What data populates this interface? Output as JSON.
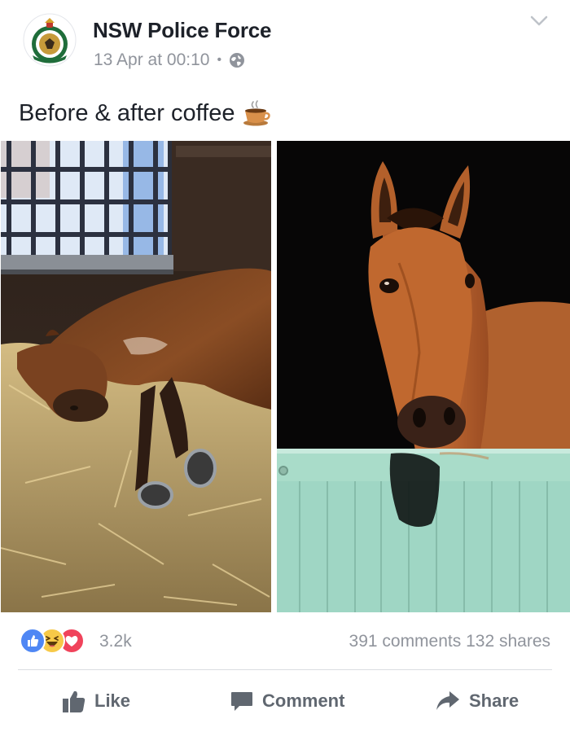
{
  "post": {
    "page_name": "NSW Police Force",
    "timestamp": "13 Apr at 00:10",
    "separator": "•",
    "privacy_icon": "globe-icon",
    "menu_icon": "chevron-down-icon",
    "text": "Before & after coffee",
    "emoji": "coffee-cup-emoji",
    "photos": [
      {
        "name": "photo-before",
        "description_icon": "sleeping-horse-photo"
      },
      {
        "name": "photo-after",
        "description_icon": "alert-horse-photo"
      }
    ]
  },
  "stats": {
    "reactions": [
      "like",
      "haha",
      "love"
    ],
    "reaction_count": "3.2k",
    "comments": "391 comments",
    "shares": "132 shares"
  },
  "actions": {
    "like_label": "Like",
    "comment_label": "Comment",
    "share_label": "Share"
  },
  "colors": {
    "like_blue": "#4f87f4",
    "haha_yellow": "#f7c948",
    "love_red": "#f0435b",
    "meta_gray": "#90949c",
    "action_gray": "#606770"
  }
}
